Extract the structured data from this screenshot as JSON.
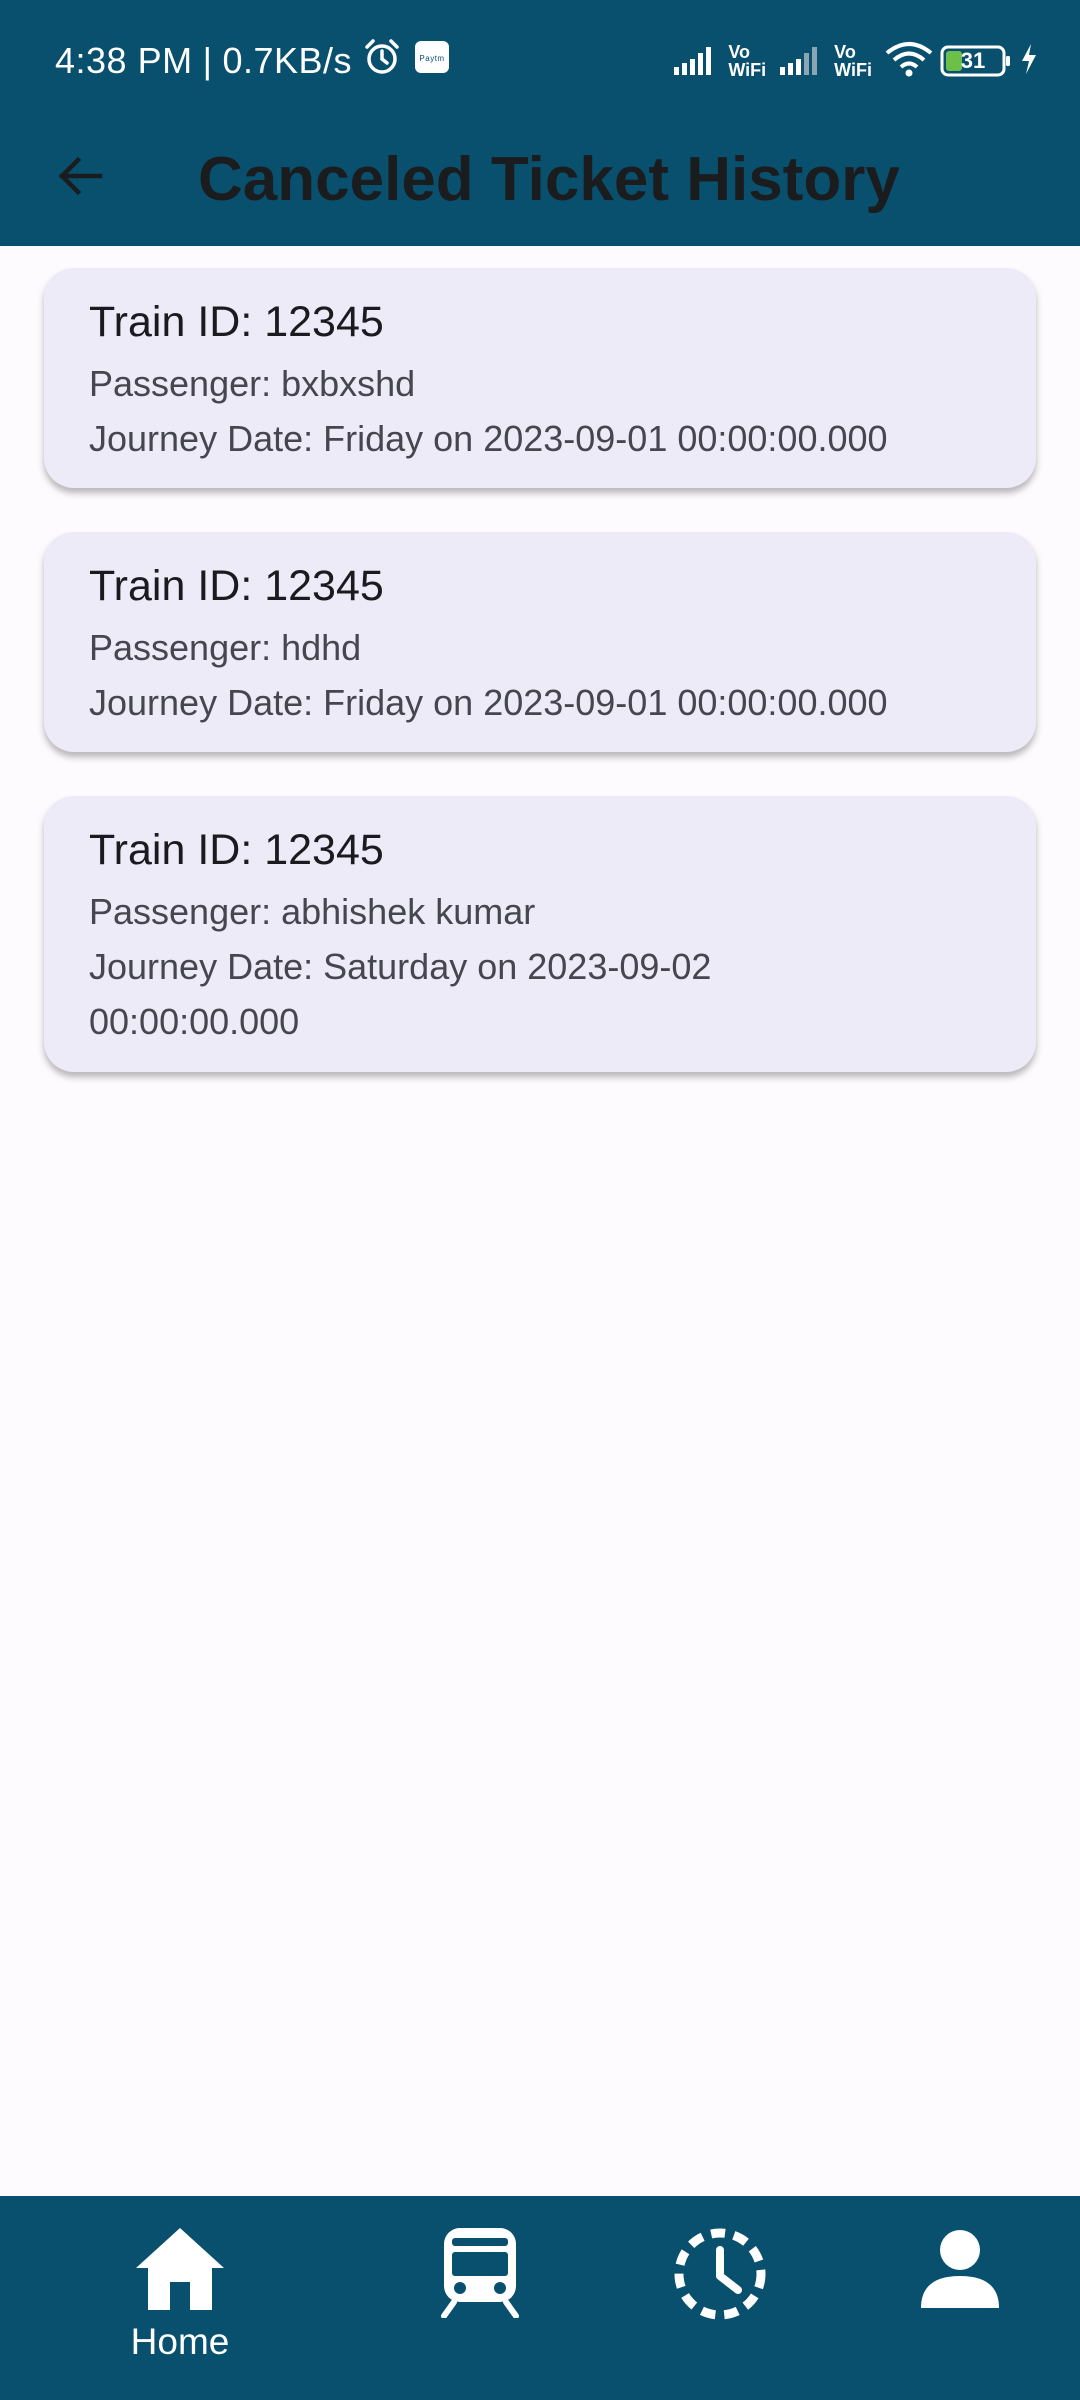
{
  "status_bar": {
    "time": "4:38 PM",
    "separator": "|",
    "speed": "0.7KB/s",
    "alarm_icon": "alarm-icon",
    "paytm_icon": "paytm-icon",
    "paytm_label": "Paytm",
    "volte_1": [
      "Vo",
      "WiFi"
    ],
    "volte_2": [
      "Vo",
      "WiFi"
    ],
    "battery_level": "31"
  },
  "app_bar": {
    "title": "Canceled Ticket History",
    "back_icon": "arrow-back-icon",
    "color": "#09506e"
  },
  "tickets": [
    {
      "title": "Train ID: 12345",
      "passenger": "Passenger: bxbxshd",
      "journey": "Journey Date: Friday on 2023-09-01 00:00:00.000"
    },
    {
      "title": "Train ID: 12345",
      "passenger": "Passenger: hdhd",
      "journey": "Journey Date: Friday on 2023-09-01 00:00:00.000"
    },
    {
      "title": "Train ID: 12345",
      "passenger": "Passenger: abhishek kumar",
      "journey_line1": "Journey Date: Saturday on 2023-09-02",
      "journey_line2": "00:00:00.000"
    }
  ],
  "bottom_nav": {
    "items": [
      {
        "icon": "home-icon",
        "label": "Home"
      },
      {
        "icon": "train-icon"
      },
      {
        "icon": "history-icon"
      },
      {
        "icon": "person-icon"
      }
    ]
  },
  "colors": {
    "primary": "#09506e",
    "card": "#eeebf8",
    "background": "#fdfbfe"
  }
}
